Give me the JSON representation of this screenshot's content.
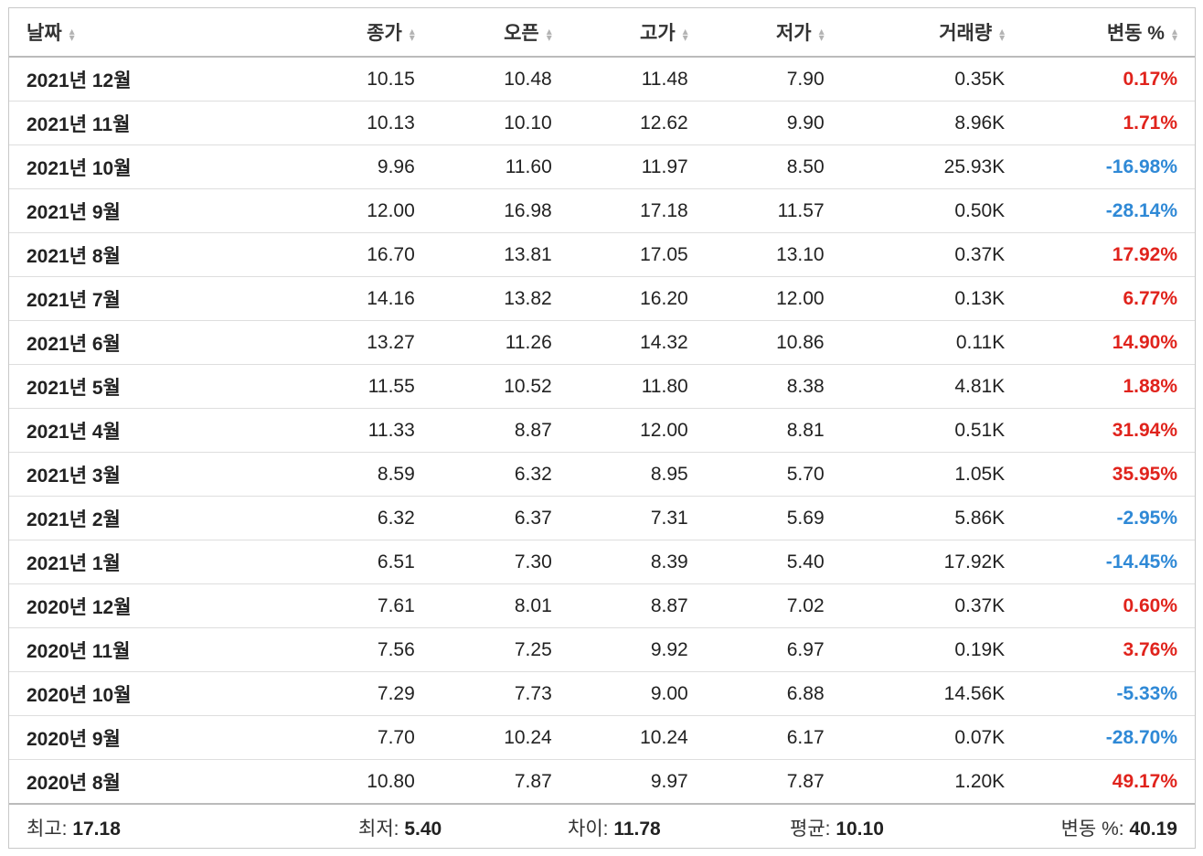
{
  "header": {
    "date": "날짜",
    "close": "종가",
    "open": "오픈",
    "high": "고가",
    "low": "저가",
    "volume": "거래량",
    "change": "변동 %"
  },
  "rows": [
    {
      "date": "2021년 12월",
      "close": "10.15",
      "open": "10.48",
      "high": "11.48",
      "low": "7.90",
      "volume": "0.35K",
      "change": "0.17%",
      "dir": "up"
    },
    {
      "date": "2021년 11월",
      "close": "10.13",
      "open": "10.10",
      "high": "12.62",
      "low": "9.90",
      "volume": "8.96K",
      "change": "1.71%",
      "dir": "up"
    },
    {
      "date": "2021년 10월",
      "close": "9.96",
      "open": "11.60",
      "high": "11.97",
      "low": "8.50",
      "volume": "25.93K",
      "change": "-16.98%",
      "dir": "down"
    },
    {
      "date": "2021년 9월",
      "close": "12.00",
      "open": "16.98",
      "high": "17.18",
      "low": "11.57",
      "volume": "0.50K",
      "change": "-28.14%",
      "dir": "down"
    },
    {
      "date": "2021년 8월",
      "close": "16.70",
      "open": "13.81",
      "high": "17.05",
      "low": "13.10",
      "volume": "0.37K",
      "change": "17.92%",
      "dir": "up"
    },
    {
      "date": "2021년 7월",
      "close": "14.16",
      "open": "13.82",
      "high": "16.20",
      "low": "12.00",
      "volume": "0.13K",
      "change": "6.77%",
      "dir": "up"
    },
    {
      "date": "2021년 6월",
      "close": "13.27",
      "open": "11.26",
      "high": "14.32",
      "low": "10.86",
      "volume": "0.11K",
      "change": "14.90%",
      "dir": "up"
    },
    {
      "date": "2021년 5월",
      "close": "11.55",
      "open": "10.52",
      "high": "11.80",
      "low": "8.38",
      "volume": "4.81K",
      "change": "1.88%",
      "dir": "up"
    },
    {
      "date": "2021년 4월",
      "close": "11.33",
      "open": "8.87",
      "high": "12.00",
      "low": "8.81",
      "volume": "0.51K",
      "change": "31.94%",
      "dir": "up"
    },
    {
      "date": "2021년 3월",
      "close": "8.59",
      "open": "6.32",
      "high": "8.95",
      "low": "5.70",
      "volume": "1.05K",
      "change": "35.95%",
      "dir": "up"
    },
    {
      "date": "2021년 2월",
      "close": "6.32",
      "open": "6.37",
      "high": "7.31",
      "low": "5.69",
      "volume": "5.86K",
      "change": "-2.95%",
      "dir": "down"
    },
    {
      "date": "2021년 1월",
      "close": "6.51",
      "open": "7.30",
      "high": "8.39",
      "low": "5.40",
      "volume": "17.92K",
      "change": "-14.45%",
      "dir": "down"
    },
    {
      "date": "2020년 12월",
      "close": "7.61",
      "open": "8.01",
      "high": "8.87",
      "low": "7.02",
      "volume": "0.37K",
      "change": "0.60%",
      "dir": "up"
    },
    {
      "date": "2020년 11월",
      "close": "7.56",
      "open": "7.25",
      "high": "9.92",
      "low": "6.97",
      "volume": "0.19K",
      "change": "3.76%",
      "dir": "up"
    },
    {
      "date": "2020년 10월",
      "close": "7.29",
      "open": "7.73",
      "high": "9.00",
      "low": "6.88",
      "volume": "14.56K",
      "change": "-5.33%",
      "dir": "down"
    },
    {
      "date": "2020년 9월",
      "close": "7.70",
      "open": "10.24",
      "high": "10.24",
      "low": "6.17",
      "volume": "0.07K",
      "change": "-28.70%",
      "dir": "down"
    },
    {
      "date": "2020년 8월",
      "close": "10.80",
      "open": "7.87",
      "high": "9.97",
      "low": "7.87",
      "volume": "1.20K",
      "change": "49.17%",
      "dir": "up"
    }
  ],
  "summary": {
    "high_label": "최고:",
    "high_value": "17.18",
    "low_label": "최저:",
    "low_value": "5.40",
    "diff_label": "차이:",
    "diff_value": "11.78",
    "avg_label": "평균:",
    "avg_value": "10.10",
    "change_label": "변동 %:",
    "change_value": "40.19"
  },
  "colors": {
    "up": "#e0231c",
    "down": "#2f89d6"
  }
}
